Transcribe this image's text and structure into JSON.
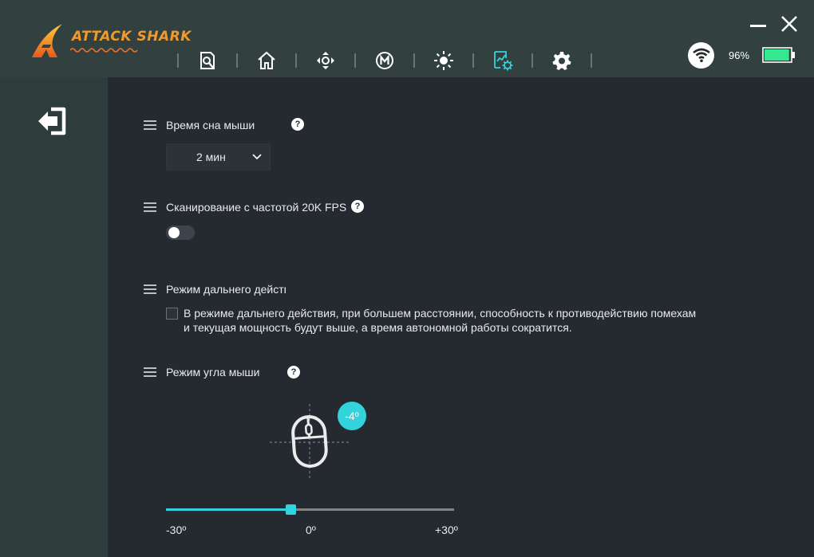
{
  "app": {
    "brand": "ATTACK SHARK"
  },
  "nav": {
    "items": [
      {
        "icon": "magnifier-document-icon",
        "active": false
      },
      {
        "icon": "home-icon",
        "active": false
      },
      {
        "icon": "move-arrows-icon",
        "active": false
      },
      {
        "icon": "macro-m-icon",
        "active": false
      },
      {
        "icon": "sun-brightness-icon",
        "active": false
      },
      {
        "icon": "performance-settings-icon",
        "active": true
      },
      {
        "icon": "gear-icon",
        "active": false
      }
    ]
  },
  "status": {
    "battery_percent": "96%",
    "battery_level": 0.96,
    "connection": "wifi-icon"
  },
  "settings": {
    "sleep": {
      "label": "Время сна мыши",
      "value": "2 мин"
    },
    "scan": {
      "label": "Сканирование с частотой 20K FPS",
      "enabled": false
    },
    "longrange": {
      "label": "Режим дальнего действия",
      "checked": false,
      "description_line1": "В режиме дальнего действия, при большем расстоянии, способность к противодействию помехам",
      "description_line2": "и текущая мощность будут выше, а время автономной работы сократится."
    },
    "angle": {
      "label": "Режим угла мыши",
      "value": -4,
      "badge": "-4º",
      "min": -30,
      "max": 30,
      "min_label": "-30º",
      "zero_label": "0º",
      "max_label": "+30º"
    }
  },
  "colors": {
    "accent": "#33d3dc",
    "header": "#32403f",
    "panel": "#252a30",
    "battery": "#33e88f"
  }
}
